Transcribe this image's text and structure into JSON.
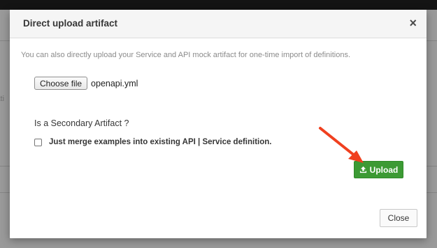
{
  "modal": {
    "title": "Direct upload artifact",
    "close_icon": "×",
    "intro_text": "You can also directly upload your Service and API mock artifact for one-time import of definitions.",
    "file_input": {
      "button_label": "Choose file",
      "selected_file": "openapi.yml"
    },
    "secondary_question": "Is a Secondary Artifact ?",
    "checkbox": {
      "label": "Just merge examples into existing API | Service definition.",
      "checked": false
    },
    "upload_button": {
      "label": "Upload",
      "icon": "upload-icon"
    },
    "close_button": {
      "label": "Close"
    }
  },
  "backdrop": {
    "partial_text": "lati"
  },
  "annotation": {
    "arrow_color": "#f0401f"
  },
  "colors": {
    "upload_green": "#3c9a34",
    "header_bg": "#f5f5f5",
    "topbar": "#141414"
  }
}
